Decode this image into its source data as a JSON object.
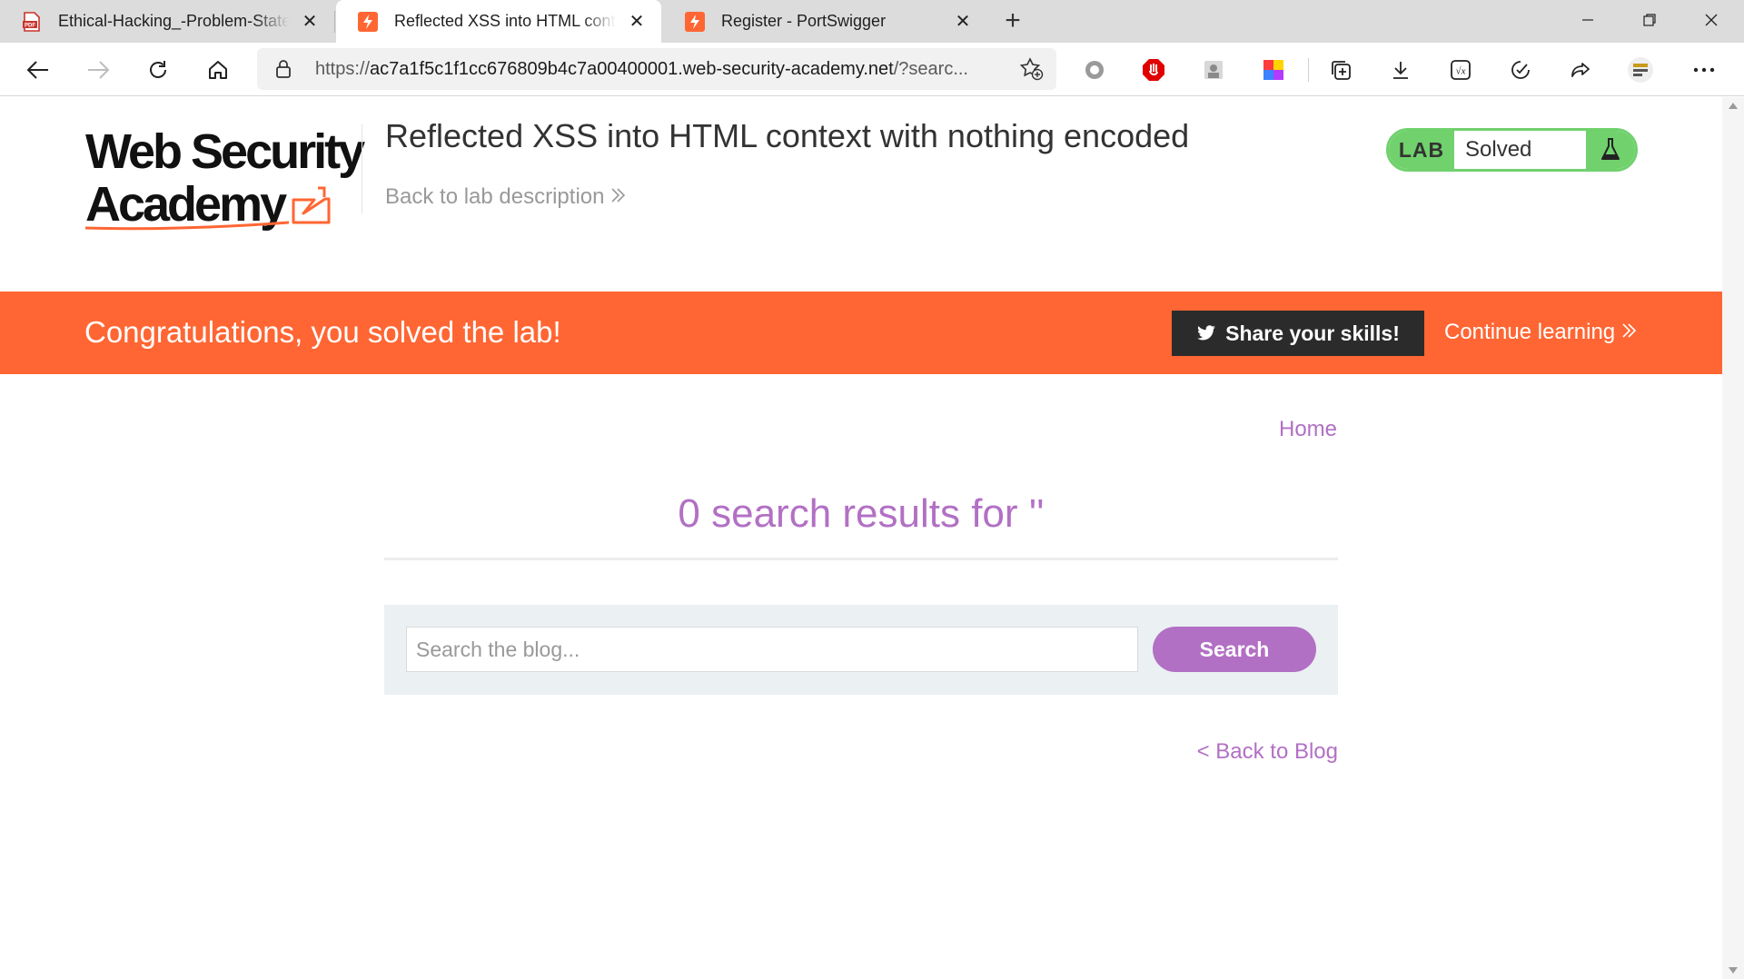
{
  "browser": {
    "tabs": [
      {
        "title": "Ethical-Hacking_-Problem-Statement",
        "icon": "pdf-icon",
        "active": false
      },
      {
        "title": "Reflected XSS into HTML context with nothing encoded",
        "icon": "portswigger-icon",
        "active": true
      },
      {
        "title": "Register - PortSwigger",
        "icon": "portswigger-icon",
        "active": false
      }
    ],
    "new_tab": "+",
    "address": {
      "scheme": "https://",
      "host": "ac7a1f5c1f1cc676809b4c7a00400001.web-security-academy.net",
      "path": "/?searc..."
    }
  },
  "header": {
    "logo_line1": "Web Security",
    "logo_line2": "Academy",
    "lab_title": "Reflected XSS into HTML context with nothing encoded",
    "back_link": "Back to lab description",
    "status_tag": "LAB",
    "status_text": "Solved"
  },
  "banner": {
    "message": "Congratulations, you solved the lab!",
    "share_label": "Share your skills!",
    "continue_label": "Continue learning"
  },
  "main": {
    "home_link": "Home",
    "results_title": "0 search results for ''",
    "search_placeholder": "Search the blog...",
    "search_button": "Search",
    "back_to_blog": "< Back to Blog"
  },
  "colors": {
    "accent": "#ff6633",
    "link": "#b270c4",
    "solved": "#70d16d"
  }
}
